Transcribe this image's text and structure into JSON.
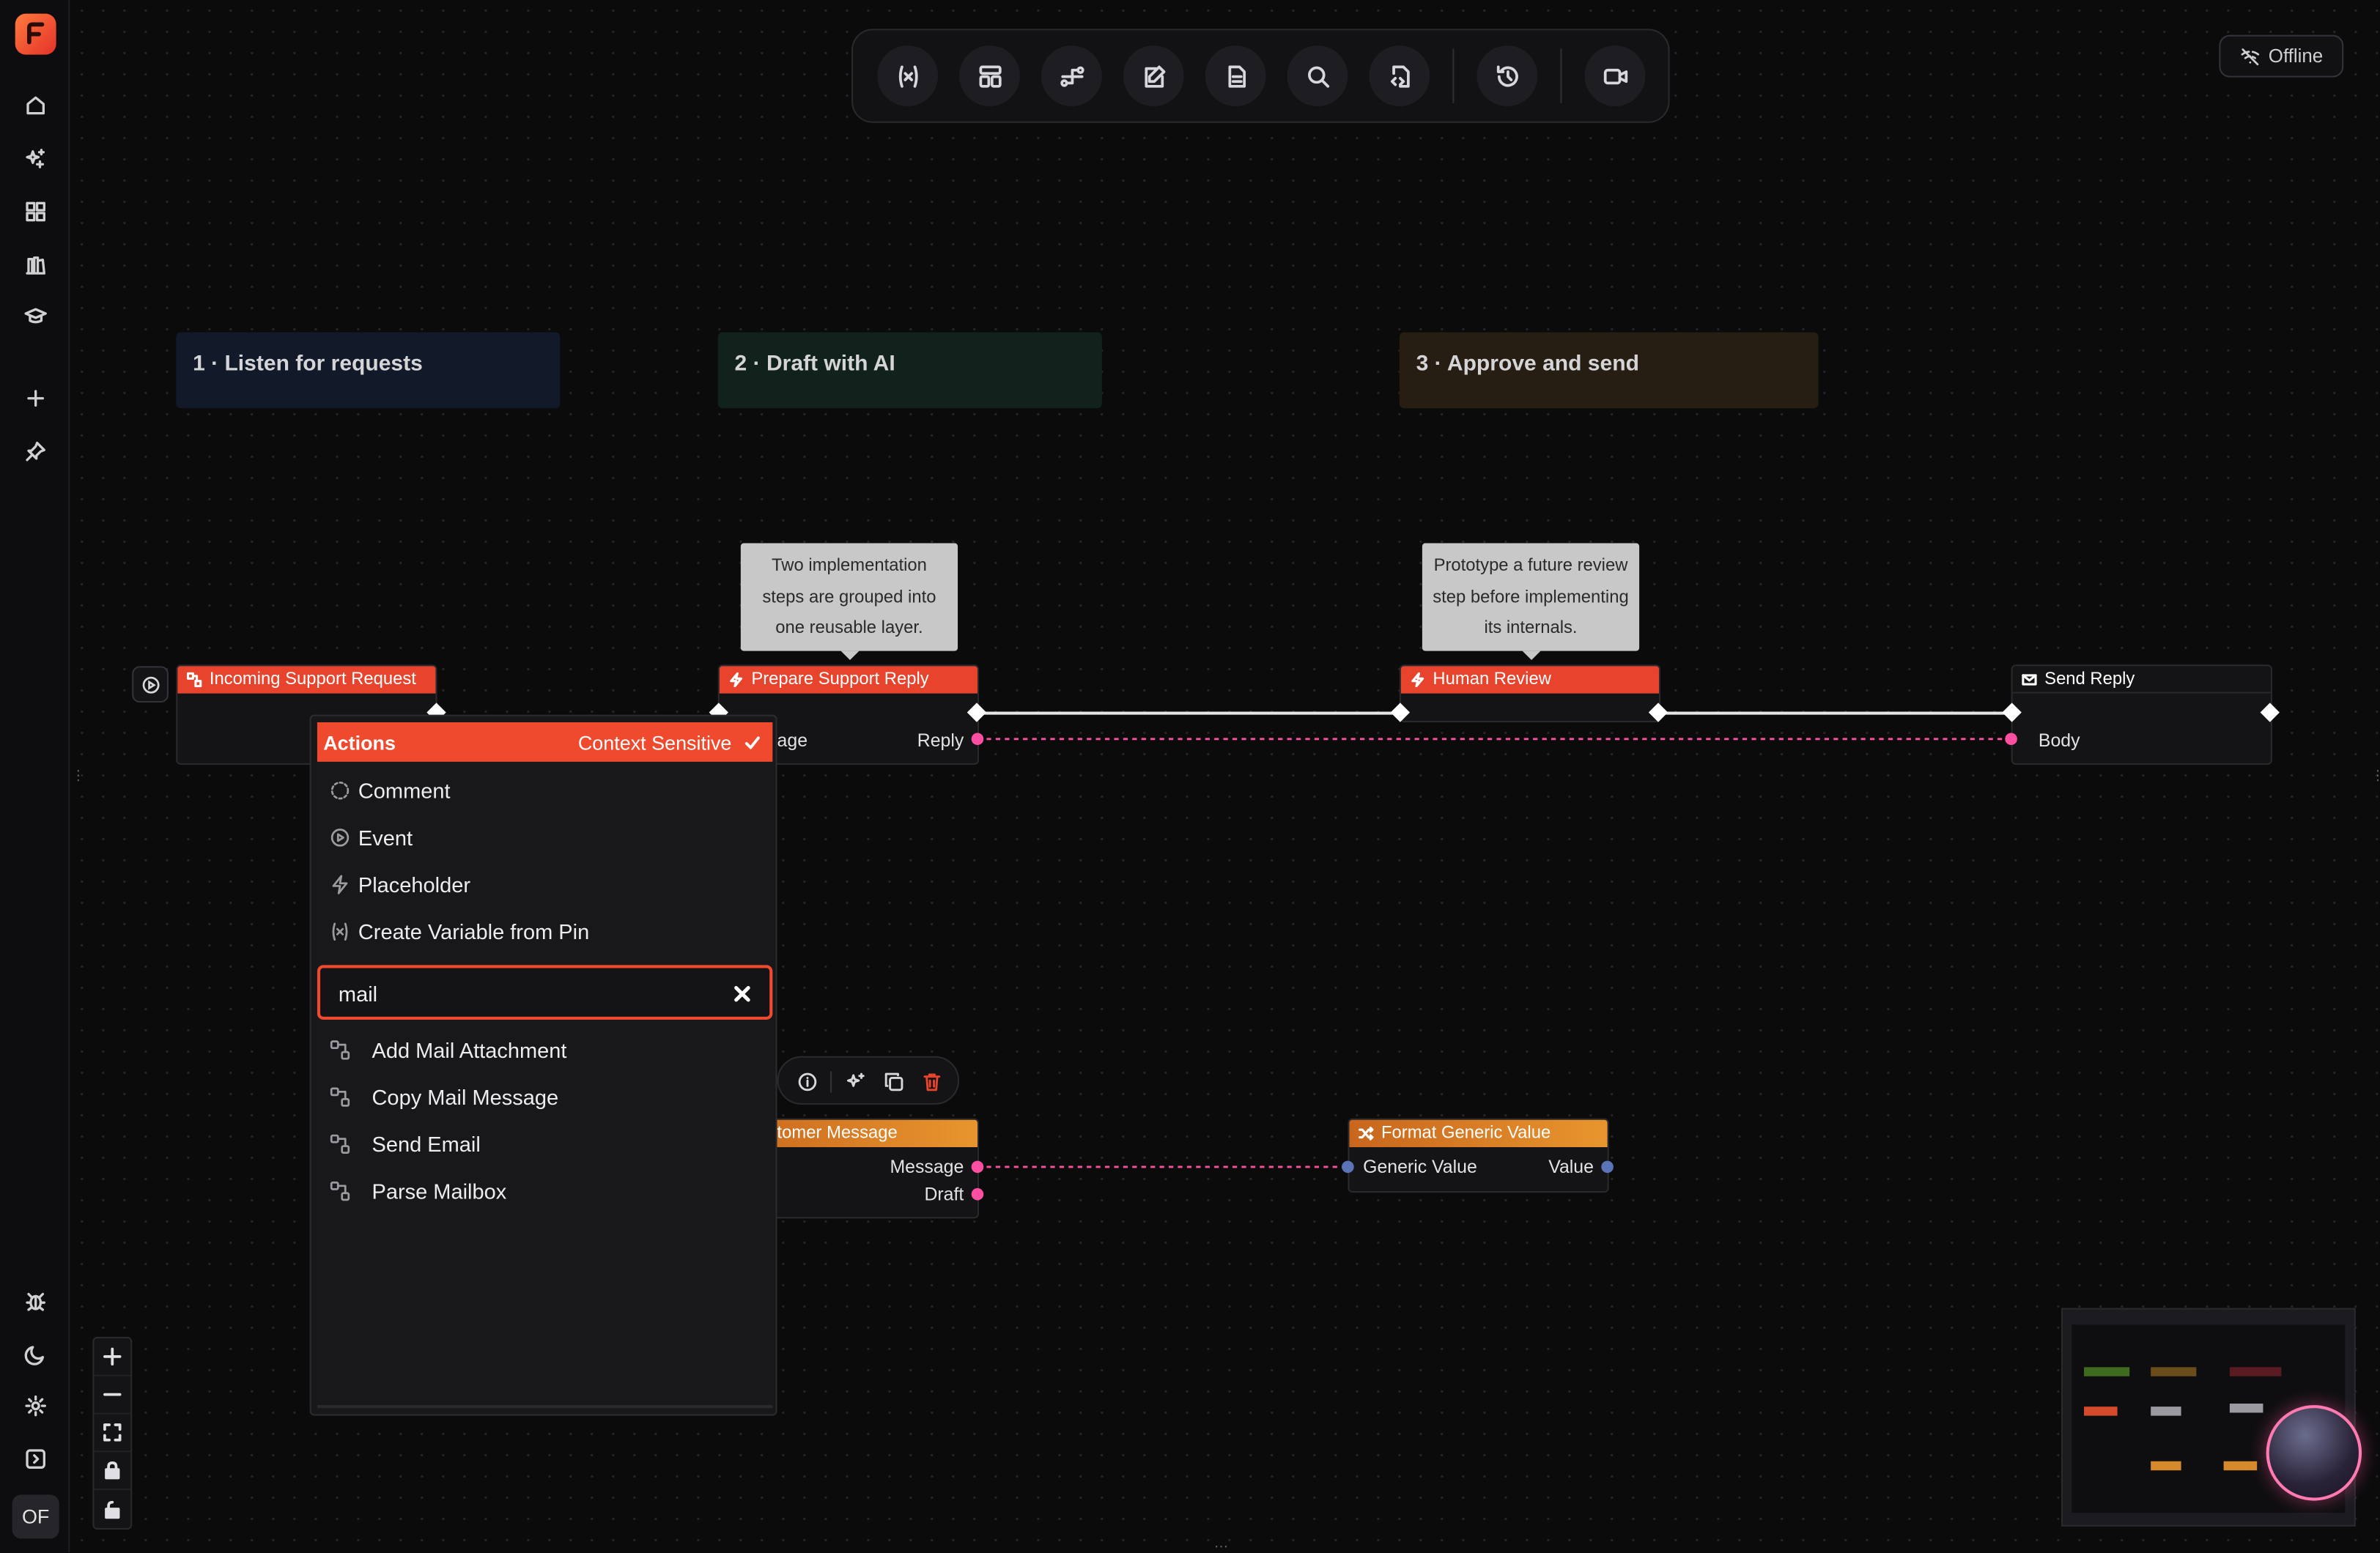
{
  "sidebar": {
    "avatar_initials": "OF",
    "icons": [
      "home-icon",
      "sparkles-icon",
      "apps-grid-icon",
      "library-icon",
      "graduation-cap-icon",
      "plus-icon",
      "pin-icon",
      "bug-icon",
      "moon-icon",
      "gear-icon",
      "panel-toggle-icon"
    ]
  },
  "toolbar": {
    "tools": [
      "variables-icon",
      "layout-icon",
      "flow-icon",
      "notes-icon",
      "document-icon",
      "search-icon",
      "code-file-icon",
      "history-icon",
      "video-icon"
    ]
  },
  "status": {
    "offline_label": "Offline"
  },
  "groups": [
    {
      "label": "1 · Listen for requests",
      "color": "#121a2a"
    },
    {
      "label": "2 · Draft with AI",
      "color": "#11221d"
    },
    {
      "label": "3 · Approve and send",
      "color": "#261e13"
    }
  ],
  "comments": [
    {
      "text": "Two implementation steps are grouped into one reusable layer."
    },
    {
      "text": "Prototype a future review step before implementing its internals."
    }
  ],
  "nodes": {
    "incoming": {
      "title": "Incoming Support Request"
    },
    "prepare": {
      "title": "Prepare Support Reply",
      "pin_left": "age",
      "pin_right": "Reply"
    },
    "human_review": {
      "title": "Human Review"
    },
    "send_reply": {
      "title": "Send Reply",
      "pin_left": "Body"
    },
    "customer_message": {
      "title": "tomer Message",
      "pin_message": "Message",
      "pin_draft": "Draft"
    },
    "format_generic": {
      "title": "Format Generic Value",
      "pin_left": "Generic Value",
      "pin_right": "Value"
    }
  },
  "actions_popup": {
    "title": "Actions",
    "context_label": "Context Sensitive",
    "context_checked": true,
    "menu": [
      {
        "label": "Comment",
        "icon": "comment-icon"
      },
      {
        "label": "Event",
        "icon": "event-icon"
      },
      {
        "label": "Placeholder",
        "icon": "placeholder-icon"
      },
      {
        "label": "Create Variable from Pin",
        "icon": "variable-icon"
      }
    ],
    "search_value": "mail",
    "results": [
      {
        "label": "Add Mail Attachment"
      },
      {
        "label": "Copy Mail Message"
      },
      {
        "label": "Send Email"
      },
      {
        "label": "Parse Mailbox"
      }
    ]
  },
  "colors": {
    "accent": "#ef4a2e",
    "pin_pink": "#ff4fa3",
    "pin_blue": "#5b74b8",
    "node_orange": "#e8952e"
  }
}
